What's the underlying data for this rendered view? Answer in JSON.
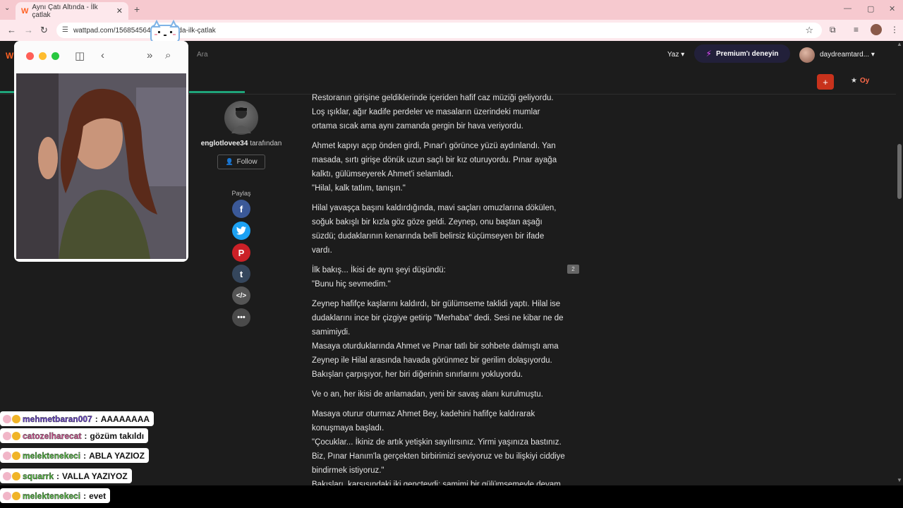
{
  "browser": {
    "tab_title": "Aynı Çatı Altında - İlk çatlak",
    "url": "wattpad.com/1568545642-...-altinda-ilk-çatlak"
  },
  "wattpad": {
    "logo": "W",
    "search_placeholder": "Ara",
    "write_label": "Yaz",
    "premium_label": "Premium'ı deneyin",
    "username": "daydreamtard...",
    "add_label": "+",
    "vote_label": "Oy"
  },
  "author": {
    "name": "englotlovee34",
    "by_suffix": "tarafından",
    "follow_label": "Follow",
    "share_label": "Paylaş"
  },
  "story": {
    "paragraphs": [
      "Restoranın girişine geldiklerinde içeriden hafif caz müziği geliyordu. Loş ışıklar, ağır kadife perdeler ve masaların üzerindeki mumlar ortama sıcak ama aynı zamanda gergin bir hava veriyordu.",
      "Ahmet kapıyı açıp önden girdi, Pınar'ı görünce yüzü aydınlandı. Yan masada, sırtı girişe dönük uzun saçlı bir kız oturuyordu. Pınar ayağa kalktı, gülümseyerek Ahmet'i selamladı.\n\"Hilal, kalk tatlım, tanışın.\"",
      "Hilal yavaşça başını kaldırdığında, mavi saçları omuzlarına dökülen, soğuk bakışlı bir kızla göz göze geldi. Zeynep, onu baştan aşağı süzdü; dudaklarının kenarında belli belirsiz küçümseyen bir ifade vardı.",
      "İlk bakış... İkisi de aynı şeyi düşündü:\n\"Bunu hiç sevmedim.\"",
      "Zeynep hafifçe kaşlarını kaldırdı, bir gülümseme taklidi yaptı. Hilal ise dudaklarını ince bir çizgiye getirip \"Merhaba\" dedi. Sesi ne kibar ne de samimiydi.\nMasaya oturduklarında Ahmet ve Pınar tatlı bir sohbete dalmıştı ama Zeynep ile Hilal arasında havada görünmez bir gerilim dolaşıyordu. Bakışları çarpışıyor, her biri diğerinin sınırlarını yokluyordu.",
      "Ve o an, her ikisi de anlamadan, yeni bir savaş alanı kurulmuştu.",
      "Masaya oturur oturmaz Ahmet Bey, kadehini hafifçe kaldırarak konuşmaya başladı.\n\"Çocuklar... İkiniz de artık yetişkin sayılırsınız. Yirmi yaşınıza bastınız. Biz, Pınar Hanım'la gerçekten birbirimizi seviyoruz ve bu ilişkiyi ciddiye bindirmek istiyoruz.\"\nBakışları, karşısındaki iki gençteydi; samimi bir gülümsemeyle devam etti..."
    ],
    "comment_count": "2"
  },
  "chat": [
    {
      "user": "mehmetbaran007",
      "message": "AAAAAAAA",
      "color": "#6a3fd8"
    },
    {
      "user": "catozelharecat",
      "message": "gözüm takıldı",
      "color": "#e0559a"
    },
    {
      "user": "melektenekeci",
      "message": "ABLA YAZIOZ",
      "color": "#4fc23a"
    },
    {
      "user": "squarrk",
      "message": "VALLA YAZIYOZ",
      "color": "#4fc23a"
    },
    {
      "user": "melektenekeci",
      "message": "evet",
      "color": "#4fc23a"
    }
  ],
  "colors": {
    "accent": "#ff6122",
    "share_facebook": "#3b5998",
    "share_twitter": "#1da1f2",
    "share_pinterest": "#cb2027",
    "share_tumblr": "#35465c",
    "share_embed": "#555555"
  }
}
